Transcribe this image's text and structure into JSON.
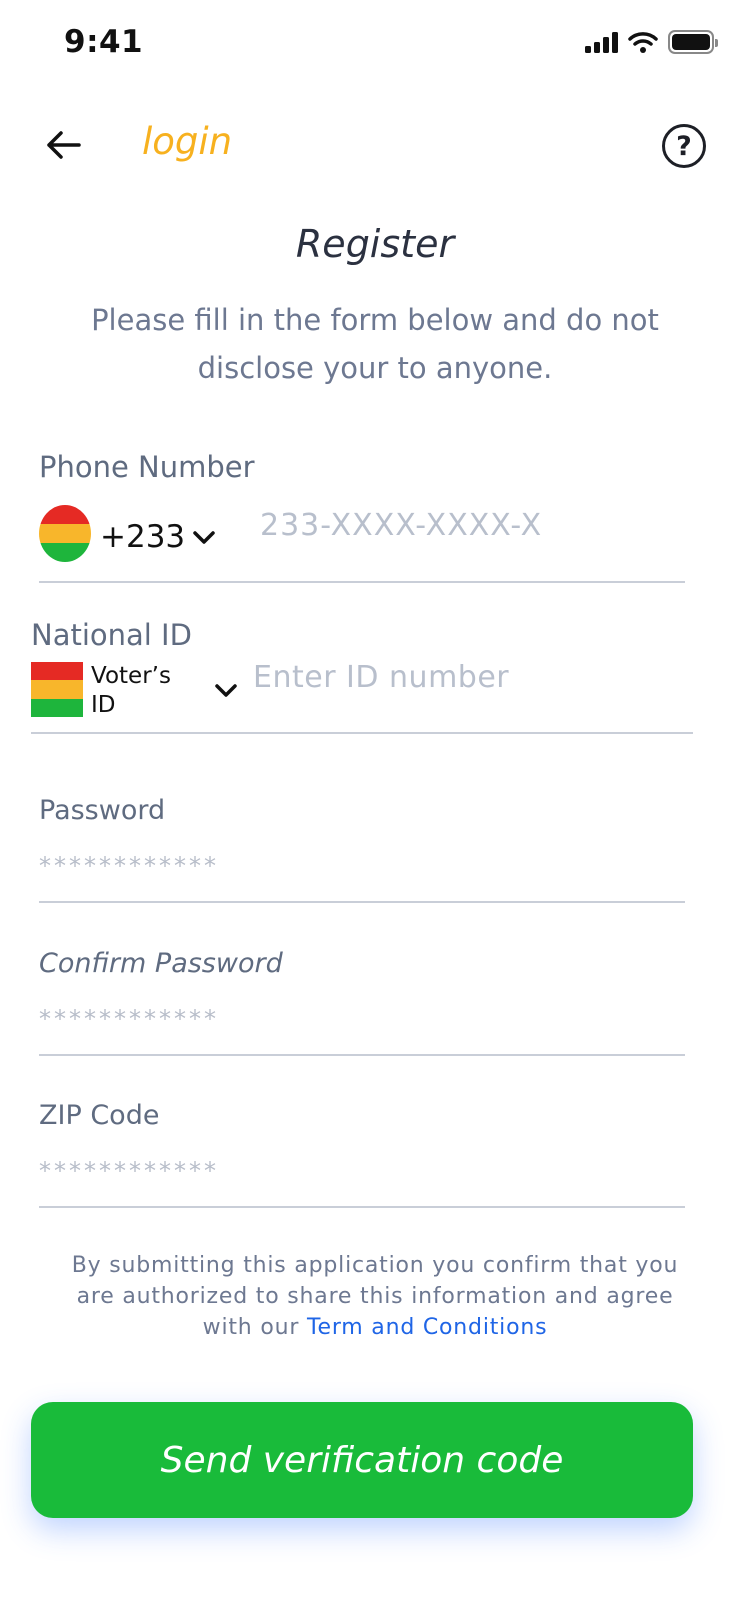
{
  "status_bar": {
    "time": "9:41"
  },
  "nav": {
    "title": "login"
  },
  "header": {
    "title": "Register",
    "subtitle": "Please fill in the form below and do not disclose your to anyone."
  },
  "phone": {
    "label": "Phone Number",
    "country_code": "+233",
    "placeholder": "233-XXXX-XXXX-X"
  },
  "national_id": {
    "label": "National ID",
    "id_type_line1": "Voter’s",
    "id_type_line2": "ID",
    "placeholder": "Enter ID number"
  },
  "password": {
    "label": "Password",
    "value": "************"
  },
  "confirm_password": {
    "label": "Confirm Password",
    "value": "************"
  },
  "zip": {
    "label": "ZIP Code",
    "value": "************"
  },
  "terms": {
    "text": "By submitting this application you confirm that you are authorized to share this information and agree with our",
    "link": "Term and Conditions"
  },
  "cta": {
    "label": "Send verification code"
  },
  "colors": {
    "brand_green": "#19bb3a",
    "nav_title": "#f7b11f",
    "link": "#1f65e6",
    "flag_red": "#e52a24",
    "flag_yellow": "#f8b62b",
    "flag_green": "#1eb53c"
  }
}
